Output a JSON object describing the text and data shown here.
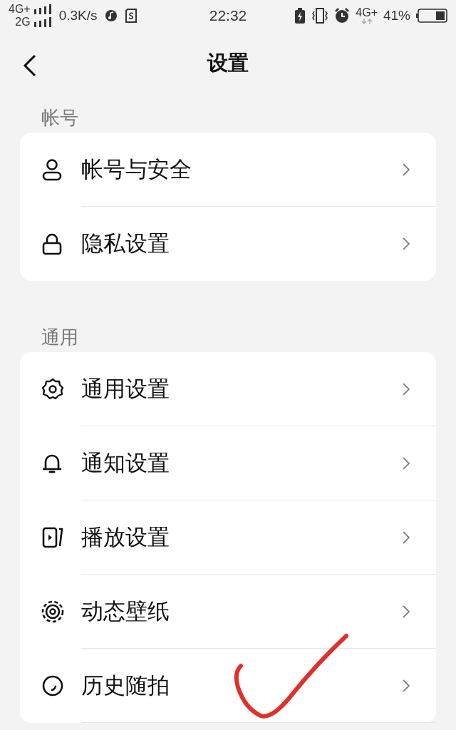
{
  "status_bar": {
    "network_top": "4G+",
    "network_bottom": "2G",
    "speed": "0.3K/s",
    "time": "22:32",
    "network_right": "4G+",
    "battery": "41%"
  },
  "header": {
    "title": "设置"
  },
  "sections": [
    {
      "title": "帐号",
      "items": [
        {
          "label": "帐号与安全"
        },
        {
          "label": "隐私设置"
        }
      ]
    },
    {
      "title": "通用",
      "items": [
        {
          "label": "通用设置"
        },
        {
          "label": "通知设置"
        },
        {
          "label": "播放设置"
        },
        {
          "label": "动态壁纸"
        },
        {
          "label": "历史随拍"
        }
      ]
    }
  ]
}
